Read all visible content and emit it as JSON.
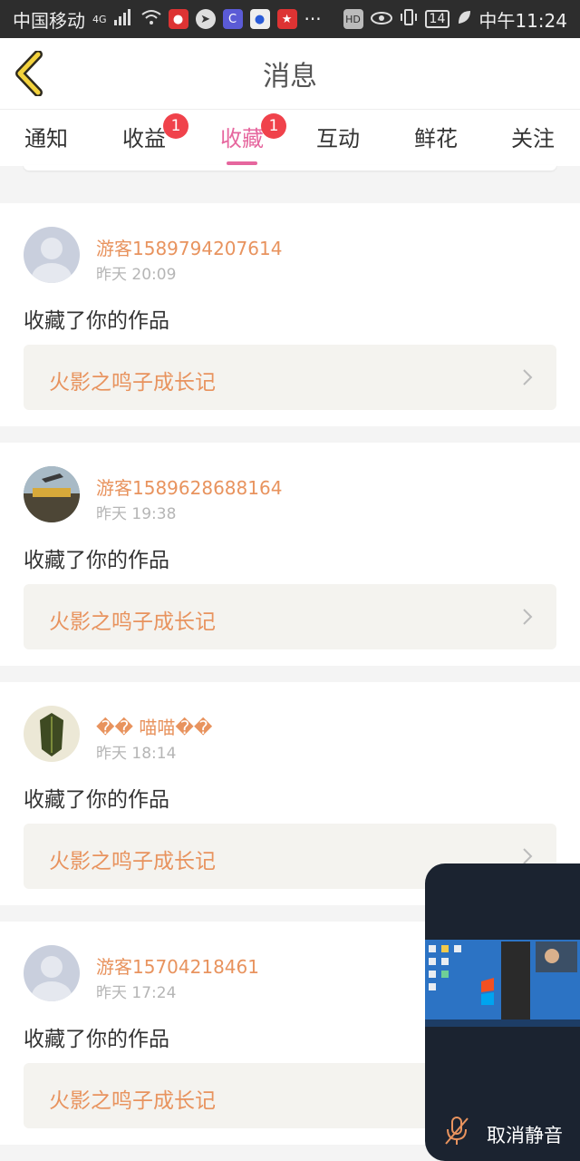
{
  "status_bar": {
    "carrier": "中国移动",
    "network": "4G",
    "more": "···",
    "battery": "14",
    "time": "中午11:24"
  },
  "header": {
    "title": "消息"
  },
  "tabs": [
    {
      "label": "通知",
      "badge": ""
    },
    {
      "label": "收益",
      "badge": "1"
    },
    {
      "label": "收藏",
      "badge": "1",
      "active": true
    },
    {
      "label": "互动",
      "badge": ""
    },
    {
      "label": "鲜花",
      "badge": ""
    },
    {
      "label": "关注",
      "badge": ""
    }
  ],
  "items": [
    {
      "username": "游客1589794207614",
      "time": "昨天 20:09",
      "action": "收藏了你的作品",
      "work": "火影之鸣子成长记",
      "avatar": "default-avatar"
    },
    {
      "username": "游客1589628688164",
      "time": "昨天 19:38",
      "action": "收藏了你的作品",
      "work": "火影之鸣子成长记",
      "avatar": "game-avatar"
    },
    {
      "username": "�� 喵喵��",
      "time": "昨天 18:14",
      "action": "收藏了你的作品",
      "work": "火影之鸣子成长记",
      "avatar": "leaf-avatar"
    },
    {
      "username": "游客15704218461",
      "time": "昨天 17:24",
      "action": "收藏了你的作品",
      "work": "火影之鸣子成长记",
      "avatar": "default-avatar"
    }
  ],
  "float_window": {
    "unmute_label": "取消静音"
  },
  "colors": {
    "accent": "#e6669e",
    "orange": "#e8935e",
    "badge": "#f0424b"
  }
}
